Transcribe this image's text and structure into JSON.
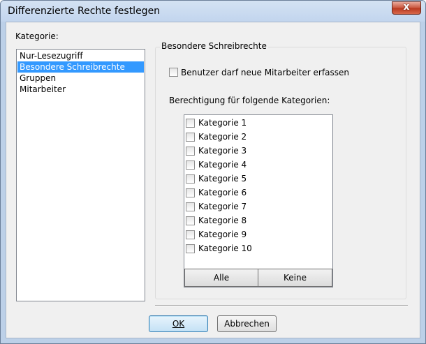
{
  "window": {
    "title": "Differenzierte Rechte festlegen",
    "close_glyph": "x"
  },
  "category_panel": {
    "label": "Kategorie:",
    "items": [
      {
        "label": "Nur-Lesezugriff",
        "selected": false
      },
      {
        "label": "Besondere Schreibrechte",
        "selected": true
      },
      {
        "label": "Gruppen",
        "selected": false
      },
      {
        "label": "Mitarbeiter",
        "selected": false
      }
    ]
  },
  "write_rights": {
    "group_title": "Besondere Schreibrechte",
    "new_employees_label": "Benutzer darf neue Mitarbeiter erfassen",
    "new_employees_checked": false,
    "categories_label": "Berechtigung für folgende Kategorien:",
    "categories": [
      {
        "label": "Kategorie 1",
        "checked": false
      },
      {
        "label": "Kategorie 2",
        "checked": false
      },
      {
        "label": "Kategorie 3",
        "checked": false
      },
      {
        "label": "Kategorie 4",
        "checked": false
      },
      {
        "label": "Kategorie 5",
        "checked": false
      },
      {
        "label": "Kategorie 6",
        "checked": false
      },
      {
        "label": "Kategorie 7",
        "checked": false
      },
      {
        "label": "Kategorie 8",
        "checked": false
      },
      {
        "label": "Kategorie 9",
        "checked": false
      },
      {
        "label": "Kategorie 10",
        "checked": false
      }
    ],
    "all_label": "Alle",
    "none_label": "Keine"
  },
  "footer": {
    "ok_label": "OK",
    "cancel_label": "Abbrechen"
  }
}
